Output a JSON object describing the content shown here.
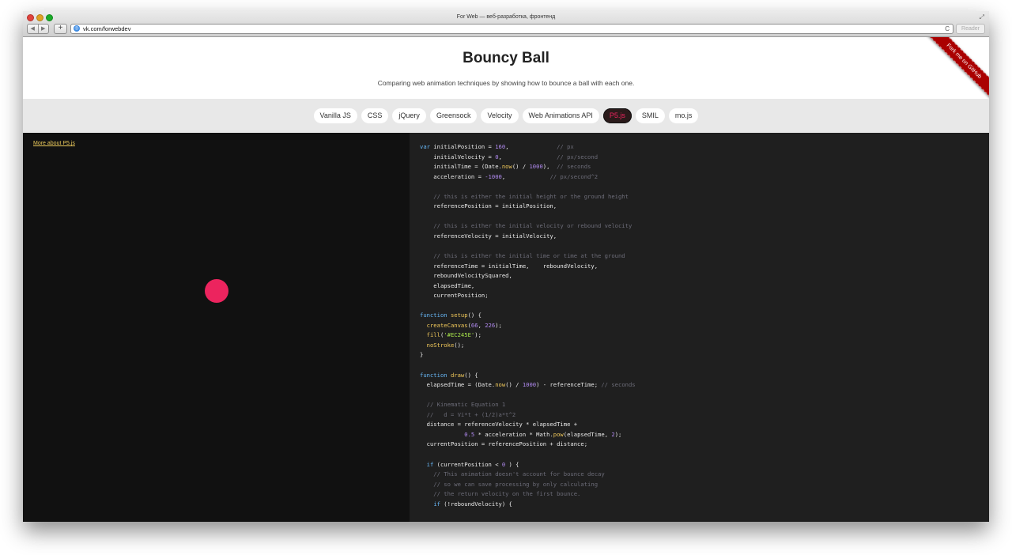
{
  "browser": {
    "window_title": "For Web — веб-разработка, фронтенд",
    "address": "vk.com/forwebdev",
    "reader_label": "Reader",
    "back_glyph": "◀",
    "forward_glyph": "▶",
    "plus_glyph": "+",
    "reload_glyph": "C",
    "fullscreen_glyph": "⤢"
  },
  "page": {
    "title": "Bouncy Ball",
    "subtitle": "Comparing web animation techniques by showing how to bounce a ball with each one.",
    "ribbon": "Fork me on GitHub"
  },
  "tabs": [
    {
      "label": "Vanilla JS",
      "active": false
    },
    {
      "label": "CSS",
      "active": false
    },
    {
      "label": "jQuery",
      "active": false
    },
    {
      "label": "Greensock",
      "active": false
    },
    {
      "label": "Velocity",
      "active": false
    },
    {
      "label": "Web Animations API",
      "active": false
    },
    {
      "label": "P5.js",
      "active": true
    },
    {
      "label": "SMIL",
      "active": false
    },
    {
      "label": "mo.js",
      "active": false
    }
  ],
  "demo": {
    "more_link": "More about P5.js",
    "ball_color": "#EC245E"
  },
  "code": {
    "lines": [
      [
        [
          "kw",
          "var"
        ],
        [
          "p",
          " initialPosition = "
        ],
        [
          "num",
          "160"
        ],
        [
          "p",
          ",              "
        ],
        [
          "cm",
          "// px"
        ]
      ],
      [
        [
          "p",
          "    initialVelocity = "
        ],
        [
          "num",
          "0"
        ],
        [
          "p",
          ",                "
        ],
        [
          "cm",
          "// px/second"
        ]
      ],
      [
        [
          "p",
          "    initialTime = (Date."
        ],
        [
          "fn",
          "now"
        ],
        [
          "p",
          "() / "
        ],
        [
          "num",
          "1000"
        ],
        [
          "p",
          "),  "
        ],
        [
          "cm",
          "// seconds"
        ]
      ],
      [
        [
          "p",
          "    acceleration = "
        ],
        [
          "num",
          "-1000"
        ],
        [
          "p",
          ",             "
        ],
        [
          "cm",
          "// px/second^2"
        ]
      ],
      [
        [
          "p",
          ""
        ]
      ],
      [
        [
          "cm",
          "    // this is either the initial height or the ground height"
        ]
      ],
      [
        [
          "p",
          "    referencePosition = initialPosition,"
        ]
      ],
      [
        [
          "p",
          ""
        ]
      ],
      [
        [
          "cm",
          "    // this is either the initial velocity or rebound velocity"
        ]
      ],
      [
        [
          "p",
          "    referenceVelocity = initialVelocity,"
        ]
      ],
      [
        [
          "p",
          ""
        ]
      ],
      [
        [
          "cm",
          "    // this is either the initial time or time at the ground"
        ]
      ],
      [
        [
          "p",
          "    referenceTime = initialTime,    reboundVelocity,"
        ]
      ],
      [
        [
          "p",
          "    reboundVelocitySquared,"
        ]
      ],
      [
        [
          "p",
          "    elapsedTime,"
        ]
      ],
      [
        [
          "p",
          "    currentPosition;"
        ]
      ],
      [
        [
          "p",
          ""
        ]
      ],
      [
        [
          "kw",
          "function"
        ],
        [
          "p",
          " "
        ],
        [
          "fn",
          "setup"
        ],
        [
          "p",
          "() {"
        ]
      ],
      [
        [
          "p",
          "  "
        ],
        [
          "fn",
          "createCanvas"
        ],
        [
          "p",
          "("
        ],
        [
          "num",
          "66"
        ],
        [
          "p",
          ", "
        ],
        [
          "num",
          "226"
        ],
        [
          "p",
          ");"
        ]
      ],
      [
        [
          "p",
          "  "
        ],
        [
          "fn",
          "fill"
        ],
        [
          "p",
          "("
        ],
        [
          "str",
          "'#EC245E'"
        ],
        [
          "p",
          ");"
        ]
      ],
      [
        [
          "p",
          "  "
        ],
        [
          "fn",
          "noStroke"
        ],
        [
          "p",
          "();"
        ]
      ],
      [
        [
          "p",
          "}"
        ]
      ],
      [
        [
          "p",
          ""
        ]
      ],
      [
        [
          "kw",
          "function"
        ],
        [
          "p",
          " "
        ],
        [
          "fn",
          "draw"
        ],
        [
          "p",
          "() {"
        ]
      ],
      [
        [
          "p",
          "  elapsedTime = (Date."
        ],
        [
          "fn",
          "now"
        ],
        [
          "p",
          "() / "
        ],
        [
          "num",
          "1000"
        ],
        [
          "p",
          ") - referenceTime; "
        ],
        [
          "cm",
          "// seconds"
        ]
      ],
      [
        [
          "p",
          ""
        ]
      ],
      [
        [
          "cm",
          "  // Kinematic Equation 1"
        ]
      ],
      [
        [
          "cm",
          "  //   d = Vi*t + (1/2)a*t^2"
        ]
      ],
      [
        [
          "p",
          "  distance = referenceVelocity * elapsedTime +"
        ]
      ],
      [
        [
          "p",
          "             "
        ],
        [
          "num",
          "0.5"
        ],
        [
          "p",
          " * acceleration * Math."
        ],
        [
          "fn",
          "pow"
        ],
        [
          "p",
          "(elapsedTime, "
        ],
        [
          "num",
          "2"
        ],
        [
          "p",
          ");"
        ]
      ],
      [
        [
          "p",
          "  currentPosition = referencePosition + distance;"
        ]
      ],
      [
        [
          "p",
          ""
        ]
      ],
      [
        [
          "p",
          "  "
        ],
        [
          "kw",
          "if"
        ],
        [
          "p",
          " (currentPosition < "
        ],
        [
          "num",
          "0"
        ],
        [
          "p",
          " ) {"
        ]
      ],
      [
        [
          "cm",
          "    // This animation doesn't account for bounce decay"
        ]
      ],
      [
        [
          "cm",
          "    // so we can save processing by only calculating"
        ]
      ],
      [
        [
          "cm",
          "    // the return velocity on the first bounce."
        ]
      ],
      [
        [
          "p",
          "    "
        ],
        [
          "kw",
          "if"
        ],
        [
          "p",
          " (!reboundVelocity) {"
        ]
      ]
    ]
  }
}
